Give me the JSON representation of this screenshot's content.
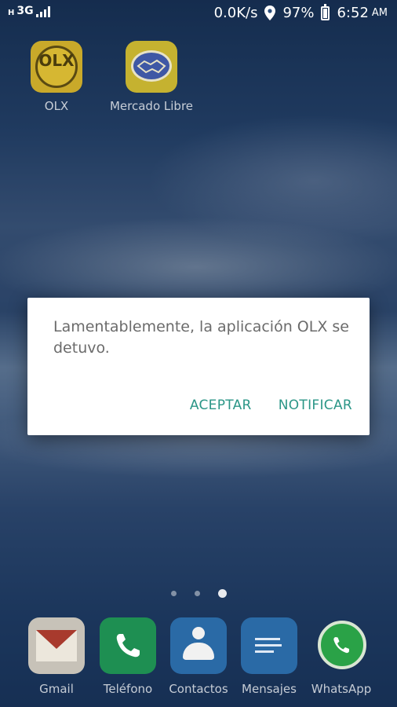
{
  "status_bar": {
    "network_prefix": "H",
    "network_type": "3G",
    "data_speed": "0.0K/s",
    "battery_percent": "97%",
    "time": "6:52",
    "am_pm": "AM",
    "icons": [
      "signal-icon",
      "location-icon",
      "battery-icon"
    ]
  },
  "home_apps": [
    {
      "label": "OLX",
      "icon": "olx-icon",
      "logo_text": "OLX"
    },
    {
      "label": "Mercado Libre",
      "icon": "handshake-icon"
    }
  ],
  "pager": {
    "count": 3,
    "active_index": 2
  },
  "dock": [
    {
      "label": "Gmail",
      "icon": "gmail-icon"
    },
    {
      "label": "Teléfono",
      "icon": "phone-icon"
    },
    {
      "label": "Contactos",
      "icon": "contacts-icon"
    },
    {
      "label": "Mensajes",
      "icon": "messages-icon"
    },
    {
      "label": "WhatsApp",
      "icon": "whatsapp-icon"
    }
  ],
  "dialog": {
    "message": "Lamentablemente, la aplicación OLX se detuvo.",
    "accept_label": "ACEPTAR",
    "notify_label": "NOTIFICAR"
  },
  "colors": {
    "dialog_button": "#2b9687",
    "dialog_text": "#6b6b6b"
  }
}
